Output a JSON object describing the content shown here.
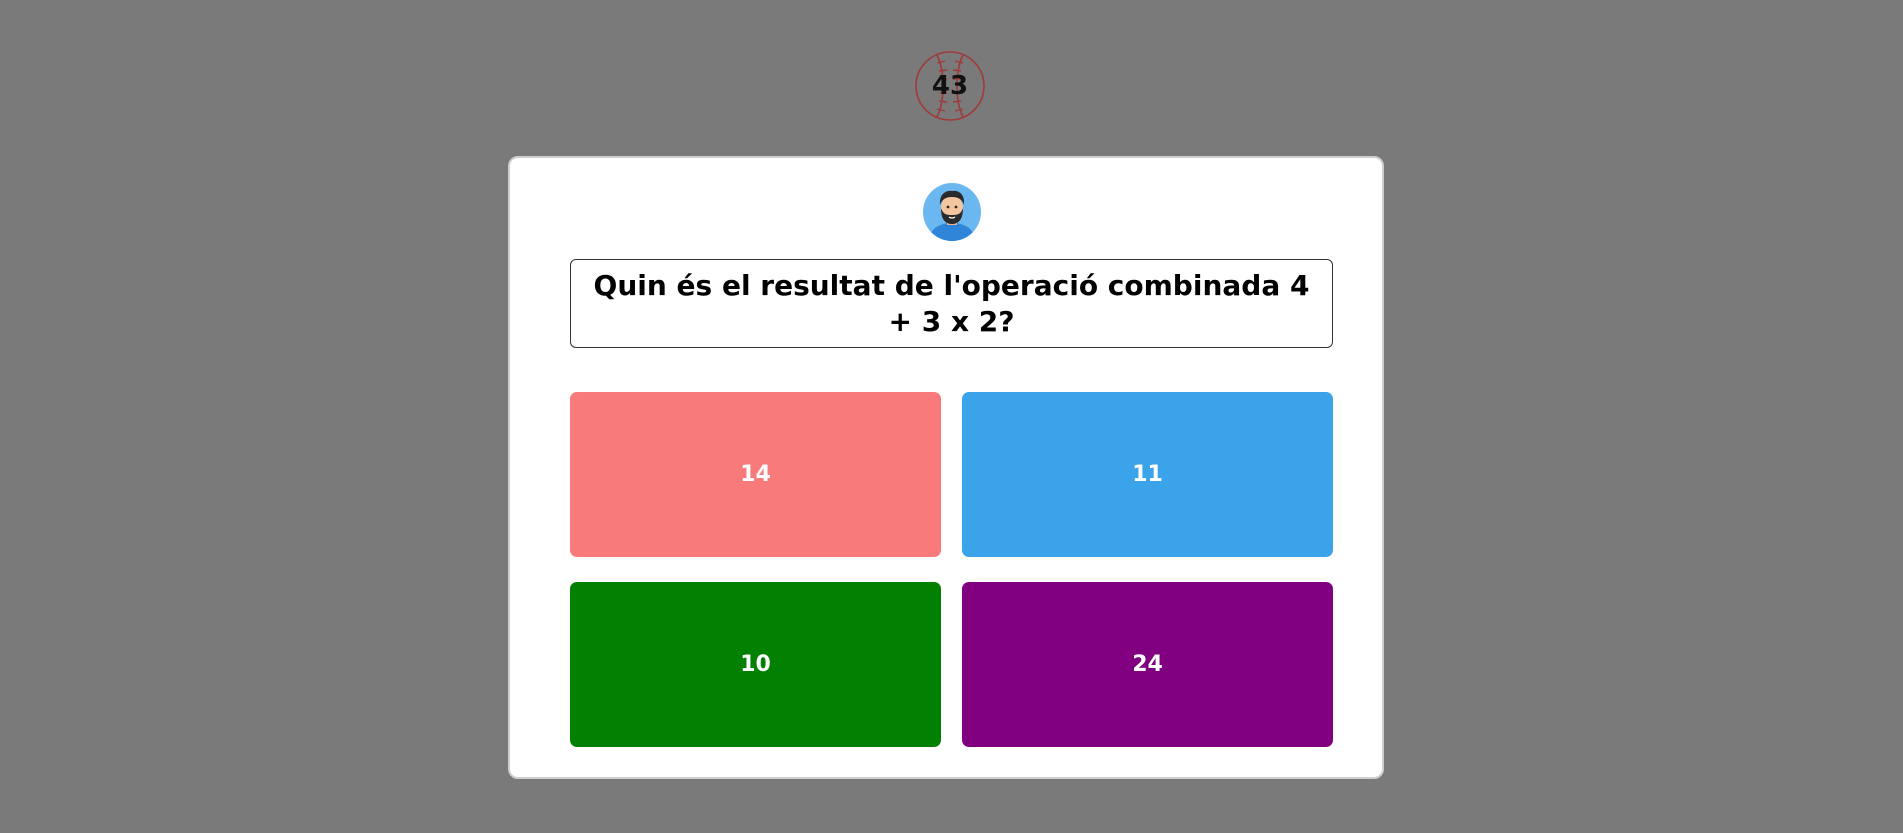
{
  "timer": {
    "value": "43",
    "icon": "baseball-icon",
    "stitch_color": "#a03a3a"
  },
  "avatar": {
    "icon": "bearded-man-avatar-icon",
    "bg_color": "#6bb8f0"
  },
  "question": {
    "text": "Quin és el resultat de l'operació combinada 4 + 3 x 2?"
  },
  "answers": [
    {
      "label": "14",
      "color": "#f87a7a"
    },
    {
      "label": "11",
      "color": "#3aa3ea"
    },
    {
      "label": "10",
      "color": "#028002"
    },
    {
      "label": "24",
      "color": "#800080"
    }
  ],
  "colors": {
    "background": "#7a7a7a",
    "card": "#ffffff"
  }
}
